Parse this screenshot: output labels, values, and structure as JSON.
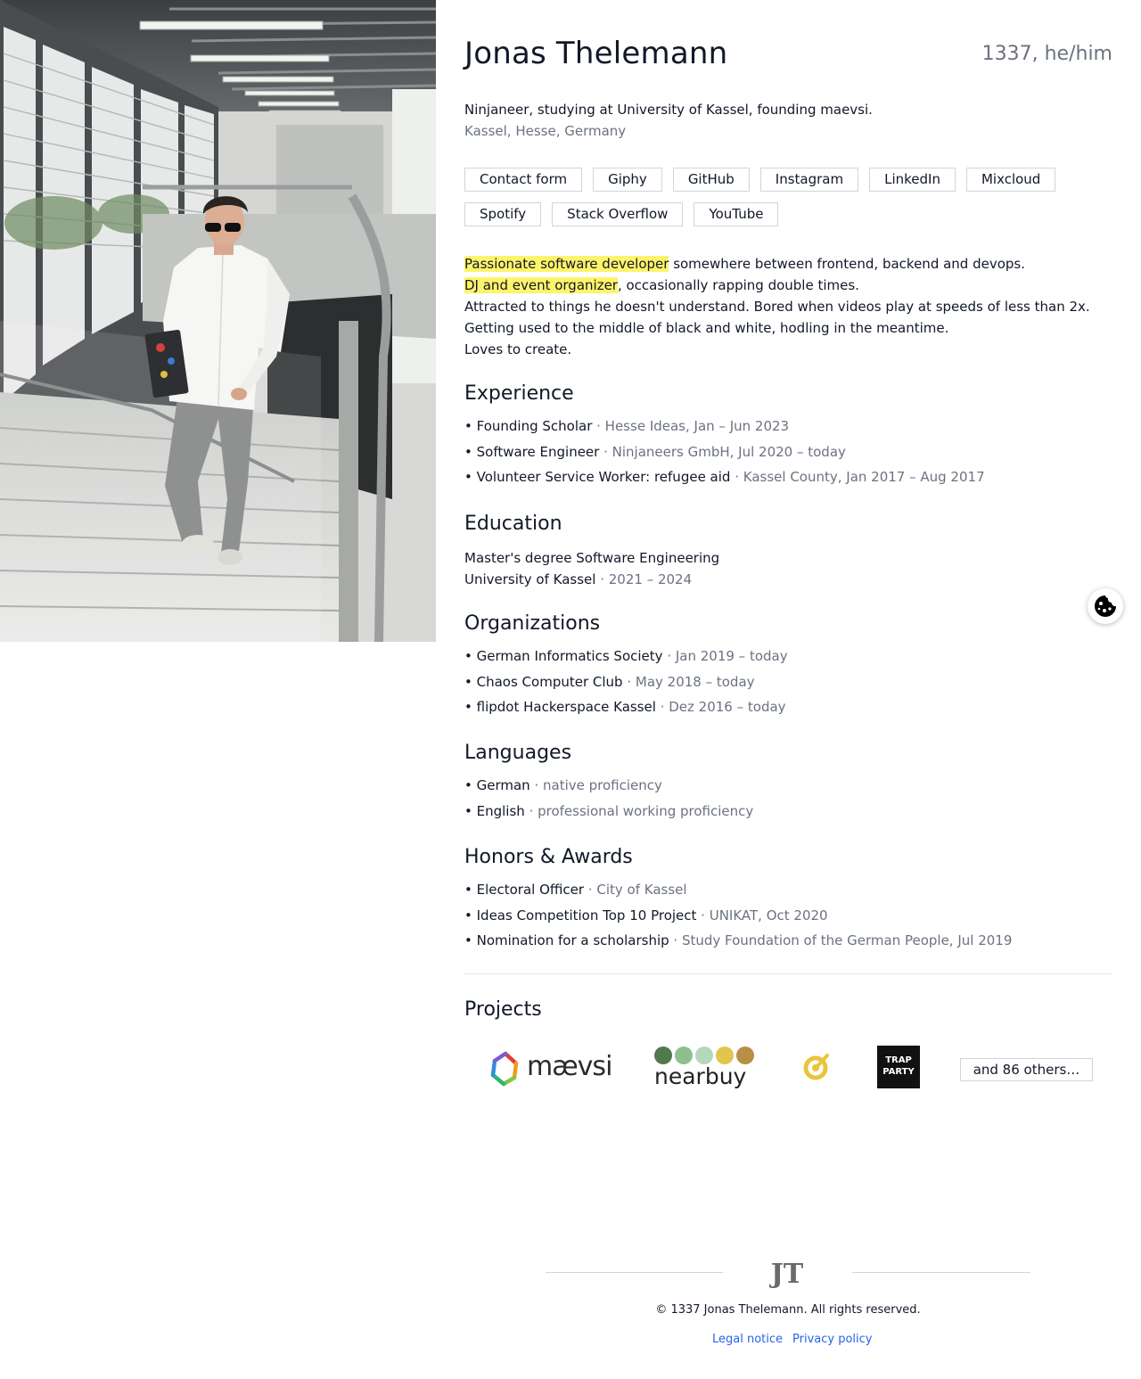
{
  "header": {
    "name": "Jonas Thelemann",
    "meta": "1337, he/him",
    "tagline": "Ninjaneer, studying at University of Kassel, founding maevsi.",
    "location": "Kassel, Hesse, Germany"
  },
  "links": [
    "Contact form",
    "Giphy",
    "GitHub",
    "Instagram",
    "LinkedIn",
    "Mixcloud",
    "Spotify",
    "Stack Overflow",
    "YouTube"
  ],
  "bio": {
    "line1_highlight": "Passionate software developer",
    "line1_rest": " somewhere between frontend, backend and devops.",
    "line2_highlight": "DJ and event organizer",
    "line2_rest": ", occasionally rapping double times.",
    "line3": "Attracted to things he doesn't understand. Bored when videos play at speeds of less than 2x.",
    "line4": "Getting used to the middle of black and white, hodling in the meantime.",
    "line5": "Loves to create."
  },
  "experience": {
    "title": "Experience",
    "items": [
      {
        "role": "Founding Scholar",
        "detail": " · Hesse Ideas, Jan – Jun 2023"
      },
      {
        "role": "Software Engineer",
        "detail": " · Ninjaneers GmbH, Jul 2020 – today"
      },
      {
        "role": "Volunteer Service Worker: refugee aid",
        "detail": " · Kassel County, Jan 2017 – Aug 2017"
      }
    ]
  },
  "education": {
    "title": "Education",
    "degree": "Master's degree Software Engineering",
    "school": "University of Kassel",
    "period": " · 2021 – 2024"
  },
  "organizations": {
    "title": "Organizations",
    "items": [
      {
        "role": "German Informatics Society",
        "detail": " · Jan 2019 – today"
      },
      {
        "role": "Chaos Computer Club",
        "detail": " · May 2018 – today"
      },
      {
        "role": "flipdot Hackerspace Kassel",
        "detail": " · Dez 2016 – today"
      }
    ]
  },
  "languages": {
    "title": "Languages",
    "items": [
      {
        "role": "German",
        "detail": " · native proficiency"
      },
      {
        "role": "English",
        "detail": " · professional working proficiency"
      }
    ]
  },
  "honors": {
    "title": "Honors & Awards",
    "items": [
      {
        "role": "Electoral Officer",
        "detail": " · City of Kassel"
      },
      {
        "role": "Ideas Competition Top 10 Project",
        "detail": " · UNIKAT, Oct 2020"
      },
      {
        "role": "Nomination for a scholarship",
        "detail": " · Study Foundation of the German People, Jul 2019"
      }
    ]
  },
  "projects": {
    "title": "Projects",
    "logos": [
      "mævsi",
      "nearbuy",
      "trap party"
    ],
    "more": "and 86 others…"
  },
  "footer": {
    "copyright": "© 1337 Jonas Thelemann. All rights reserved.",
    "legal_notice": "Legal notice",
    "privacy_policy": "Privacy policy",
    "logo": "JT"
  },
  "colors": {
    "highlight": "#fef46b",
    "link": "#2563eb",
    "muted": "#6b7280"
  },
  "icons": [
    "cookie-icon"
  ]
}
